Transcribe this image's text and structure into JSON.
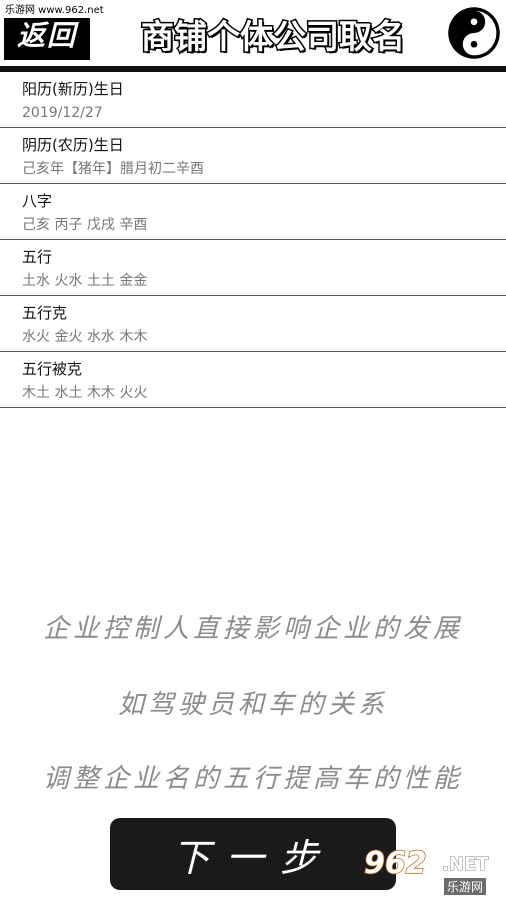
{
  "watermark": "乐游网 www.962.net",
  "header": {
    "back_label": "返回",
    "title": "商铺个体公司取名"
  },
  "rows": [
    {
      "label": "阳历(新历)生日",
      "value": "2019/12/27"
    },
    {
      "label": "阴历(农历)生日",
      "value": "己亥年【猪年】腊月初二辛酉"
    },
    {
      "label": "八字",
      "value": "己亥 丙子 戊戌 辛酉"
    },
    {
      "label": "五行",
      "value": "土水 火水 土土 金金"
    },
    {
      "label": "五行克",
      "value": "水火 金火 水水 木木"
    },
    {
      "label": "五行被克",
      "value": "木土 水土 木木 火火"
    }
  ],
  "slogans": [
    "企业控制人直接影响企业的发展",
    "如驾驶员和车的关系",
    "调整企业名的五行提高车的性能"
  ],
  "next_label": "下一步",
  "logo": {
    "big": "962",
    "net": ".NET",
    "sub": "乐游网"
  }
}
